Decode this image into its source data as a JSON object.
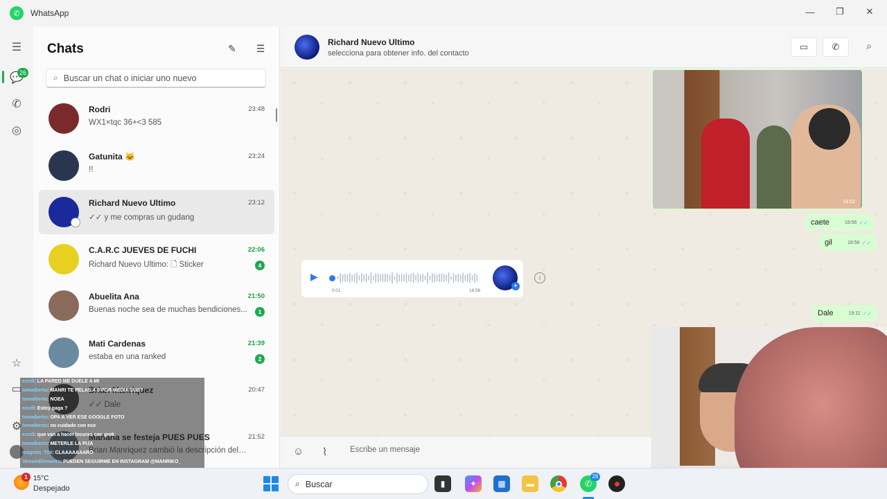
{
  "app": {
    "title": "WhatsApp"
  },
  "rail": {
    "chats_badge": "26"
  },
  "chatlist": {
    "title": "Chats",
    "search_placeholder": "Buscar un chat o iniciar uno nuevo",
    "items": [
      {
        "name": "Rodri",
        "preview": "WX1×tqc 36+<3 585",
        "time": "23:48",
        "unread": "",
        "avatar_color": "#7a2a2a",
        "selected": false
      },
      {
        "name": "Gatunita 🐱",
        "preview": "!!",
        "time": "23:24",
        "unread": "",
        "avatar_color": "#2a3650",
        "selected": false
      },
      {
        "name": "Richard Nuevo Ultimo",
        "preview": "✓✓ y me compras un gudang",
        "time": "23:12",
        "unread": "",
        "avatar_color": "#1a2a9a",
        "selected": true
      },
      {
        "name": "C.A.R.C JUEVES DE FUCHI",
        "preview": "Richard Nuevo Ultimo: 🗋 Sticker",
        "time": "22:06",
        "unread": "4",
        "avatar_color": "#e8d020",
        "selected": false
      },
      {
        "name": "Abuelita Ana",
        "preview": "Buenas  noche  sea de muchas  bendiciones...",
        "time": "21:50",
        "unread": "1",
        "avatar_color": "#8a6a5a",
        "selected": false
      },
      {
        "name": "Mati Cardenas",
        "preview": "estaba en una ranked",
        "time": "21:39",
        "unread": "2",
        "avatar_color": "#6a8aa0",
        "selected": false
      },
      {
        "name": "Brian Manriquez",
        "preview": "✓✓ Dale",
        "time": "20:47",
        "unread": "",
        "avatar_color": "#3a3a3a",
        "selected": false
      },
      {
        "name": "Mañana se festeja PUES PUES",
        "preview": "Brian Manriquez cambió la descripción del g...",
        "time": "21:52",
        "unread": "",
        "avatar_color": "#5a6a7a",
        "selected": false
      }
    ]
  },
  "stream_chat": [
    {
      "user": "ezvdl",
      "msg": ": LA PARED ME DUELE A MI"
    },
    {
      "user": "tomaiberto",
      "msg": ": MANRI TE PELAS A 0 POR MEDIA SUB?"
    },
    {
      "user": "tomaiberto",
      "msg": ": NOEA"
    },
    {
      "user": "ezvdl",
      "msg": ": Estoy gaga ?"
    },
    {
      "user": "tomaiberto",
      "msg": ": OPA A VER ESE GOOGLE FOTO"
    },
    {
      "user": "tomaiberto",
      "msg": ": no cuidado con eso"
    },
    {
      "user": "ezvdl",
      "msg": ": que van a hacer locuras con grok"
    },
    {
      "user": "tomaiberto",
      "msg": ": METERLE LA PIJA"
    },
    {
      "user": "magnito_T04",
      "msg": ": CLAAAAAAARO"
    },
    {
      "user": "StreamElements",
      "msg": ": PUEDEN SEGUIRME EN INSTAGRAM @MANRIKO_"
    }
  ],
  "conversation": {
    "contact_name": "Richard Nuevo Ultimo",
    "contact_sub": "selecciona para obtener info. del contacto",
    "image_time": "18:52",
    "messages": [
      {
        "text": "caete",
        "time": "18:56"
      },
      {
        "text": "gil",
        "time": "18:56"
      },
      {
        "text": "Dale",
        "time": "19:11"
      }
    ],
    "audio": {
      "elapsed": "0:01",
      "time": "18:56"
    }
  },
  "composer": {
    "placeholder": "Escribe un mensaje"
  },
  "taskbar": {
    "weather_temp": "15°C",
    "weather_desc": "Despejado",
    "weather_badge": "1",
    "search_label": "Buscar",
    "whatsapp_badge": "26"
  },
  "colors": {
    "accent": "#1da851",
    "bubble_out": "#d9fdd3",
    "tick": "#53bdeb"
  }
}
